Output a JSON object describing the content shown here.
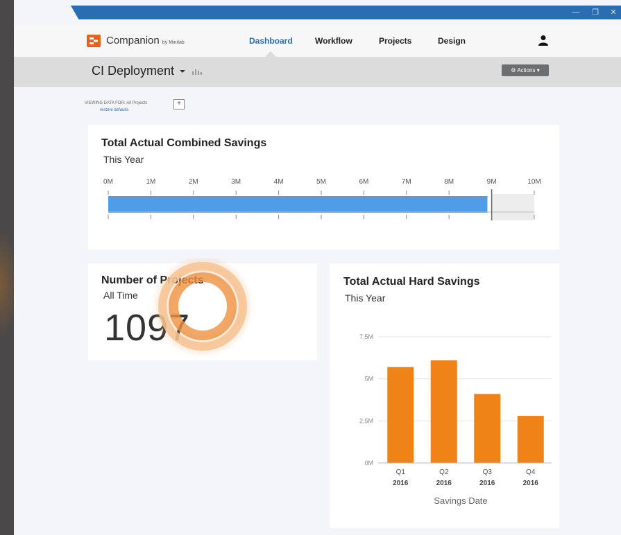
{
  "app": {
    "brand": "Companion",
    "brand_by": "by Minitab",
    "logo_glyph": "▪"
  },
  "nav": {
    "items": [
      {
        "label": "Dashboard",
        "active": true
      },
      {
        "label": "Workflow",
        "active": false
      },
      {
        "label": "Projects",
        "active": false
      },
      {
        "label": "Design",
        "active": false
      }
    ]
  },
  "window_controls": [
    "—",
    "❐",
    "✕"
  ],
  "subheader": {
    "title": "CI Deployment",
    "actions_label": "Actions"
  },
  "filter": {
    "viewing_label": "VIEWING DATA FOR:",
    "viewing_value": "All Projects",
    "add_label": "+",
    "restore_label": "restore defaults"
  },
  "cards": {
    "combined": {
      "title": "Total Actual Combined Savings",
      "subtitle": "This Year"
    },
    "projects": {
      "title": "Number of Projects",
      "subtitle": "All Time",
      "value": "1097"
    },
    "hard": {
      "title": "Total Actual Hard Savings",
      "subtitle": "This Year"
    }
  },
  "colors": {
    "accent": "#2a6db0",
    "bar_blue": "#4f9de8",
    "bar_orange": "#ef8318",
    "brand_orange": "#e8601c"
  },
  "chart_data": [
    {
      "type": "bar",
      "orientation": "horizontal",
      "title": "Total Actual Combined Savings",
      "subtitle": "This Year",
      "ticks": [
        "0M",
        "1M",
        "2M",
        "3M",
        "4M",
        "5M",
        "6M",
        "7M",
        "8M",
        "9M",
        "10M"
      ],
      "xlim": [
        0,
        10
      ],
      "values": [
        8.9
      ],
      "target": 9
    },
    {
      "type": "bar",
      "title": "Total Actual Hard Savings",
      "subtitle": "This Year",
      "categories": [
        "Q1",
        "Q2",
        "Q3",
        "Q4"
      ],
      "category_years": [
        "2016",
        "2016",
        "2016",
        "2016"
      ],
      "values": [
        5.7,
        6.1,
        4.1,
        2.8
      ],
      "ylim": [
        0,
        7.5
      ],
      "yticks": [
        "0M",
        "2.5M",
        "5M",
        "7.5M"
      ],
      "ytick_values": [
        0,
        2.5,
        5,
        7.5
      ],
      "xlabel": "Savings Date",
      "grid": true
    }
  ]
}
